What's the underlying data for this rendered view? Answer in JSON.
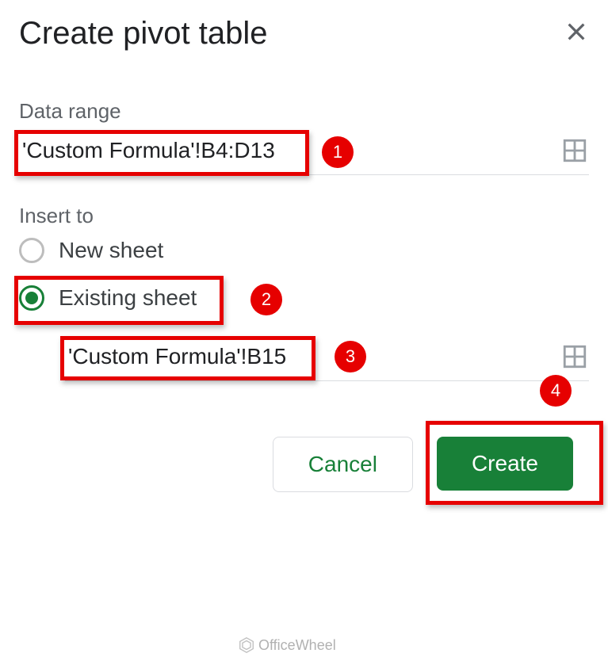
{
  "dialog": {
    "title": "Create pivot table",
    "data_range_label": "Data range",
    "data_range_value": "'Custom Formula'!B4:D13",
    "insert_to_label": "Insert to",
    "new_sheet_label": "New sheet",
    "existing_sheet_label": "Existing sheet",
    "existing_sheet_value": "'Custom Formula'!B15",
    "cancel_label": "Cancel",
    "create_label": "Create"
  },
  "annotations": {
    "badge1": "1",
    "badge2": "2",
    "badge3": "3",
    "badge4": "4"
  },
  "watermark": "OfficeWheel"
}
